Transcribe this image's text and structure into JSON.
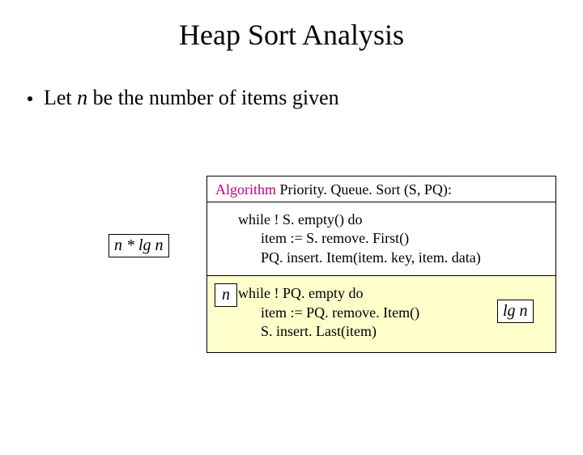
{
  "title": "Heap Sort Analysis",
  "bullet": {
    "pre": "Let ",
    "n": "n",
    "post": " be the number of items given"
  },
  "algo": {
    "keyword": "Algorithm",
    "sig": " Priority. Queue. Sort (S, PQ):",
    "b1_l1": "while ! S. empty() do",
    "b1_l2": "item := S. remove. First()",
    "b1_l3": "PQ. insert. Item(item. key, item. data)",
    "b2_l1": "while ! PQ. empty do",
    "b2_l2": "item := PQ. remove. Item()",
    "b2_l3": "S. insert. Last(item)"
  },
  "annot": {
    "nlgn": "n * lg n",
    "n": "n",
    "lgn": "lg n"
  }
}
